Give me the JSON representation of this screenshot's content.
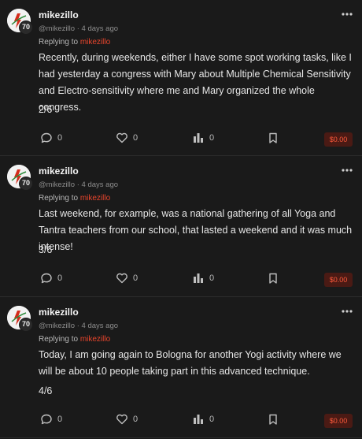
{
  "posts": [
    {
      "author": "mikezillo",
      "handle": "@mikezillo",
      "time": "4 days ago",
      "reputation": "70",
      "replying_label": "Replying to",
      "replying_to": "mikezillo",
      "body": "Recently, during weekends, either I have some spot working tasks, like I had yesterday a congress with Mary about Multiple Chemical Sensitivity and Electro-sensitivity where me and Mary organized the whole congress.",
      "counter": "2/6",
      "comments": "0",
      "votes": "0",
      "stats": "0",
      "payout": "$0.00"
    },
    {
      "author": "mikezillo",
      "handle": "@mikezillo",
      "time": "4 days ago",
      "reputation": "70",
      "replying_label": "Replying to",
      "replying_to": "mikezillo",
      "body": "Last weekend, for example, was a national gathering of all Yoga and Tantra teachers from our school, that lasted a weekend and it was much intense!",
      "counter": "3/6",
      "comments": "0",
      "votes": "0",
      "stats": "0",
      "payout": "$0.00"
    },
    {
      "author": "mikezillo",
      "handle": "@mikezillo",
      "time": "4 days ago",
      "reputation": "70",
      "replying_label": "Replying to",
      "replying_to": "mikezillo",
      "body": "Today, I am going again to Bologna for another Yogi activity where we will be about 10 people taking part in this advanced technique.",
      "counter": "4/6",
      "comments": "0",
      "votes": "0",
      "stats": "0",
      "payout": "$0.00"
    }
  ],
  "meta_separator": "·",
  "colors": {
    "background": "#1a1a1a",
    "accent": "#e8452c",
    "payout_bg": "#4a1a14"
  },
  "icons": [
    "avatar",
    "more-options-icon",
    "comment-icon",
    "heart-icon",
    "bar-chart-icon",
    "bookmark-icon"
  ]
}
